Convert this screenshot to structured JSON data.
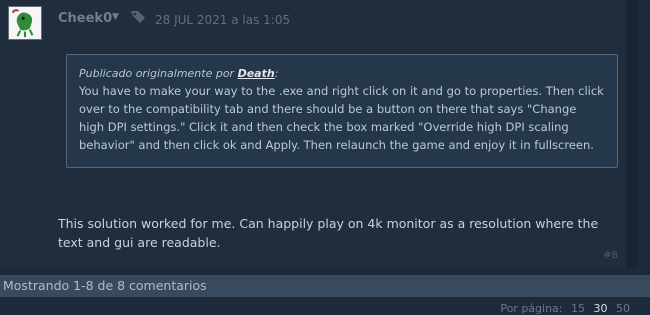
{
  "author": {
    "name": "Cheek0"
  },
  "post_date": "28 JUL 2021 a las 1:05",
  "quote": {
    "prefix": "Publicado originalmente por ",
    "author": "Death",
    "suffix": ":",
    "text": "You have to make your way to the .exe and right click on it and go to properties. Then click over to the compatibility tab and there should be a button on there that says \"Change high DPI settings.\" Click it and then check the box marked \"Override high DPI scaling behavior\" and then click ok and Apply. Then relaunch the game and enjoy it in fullscreen."
  },
  "reply_text": "This solution worked for me. Can happily play on 4k monitor as a resolution where the text and gui are readable.",
  "post_number": "#8",
  "showing": "Mostrando 1-8 de 8 comentarios",
  "per_page": {
    "label": "Por página:",
    "options": [
      "15",
      "30",
      "50"
    ],
    "selected": "30"
  },
  "icons": {
    "caret": "chevron-down-icon",
    "tag": "tag-icon"
  }
}
